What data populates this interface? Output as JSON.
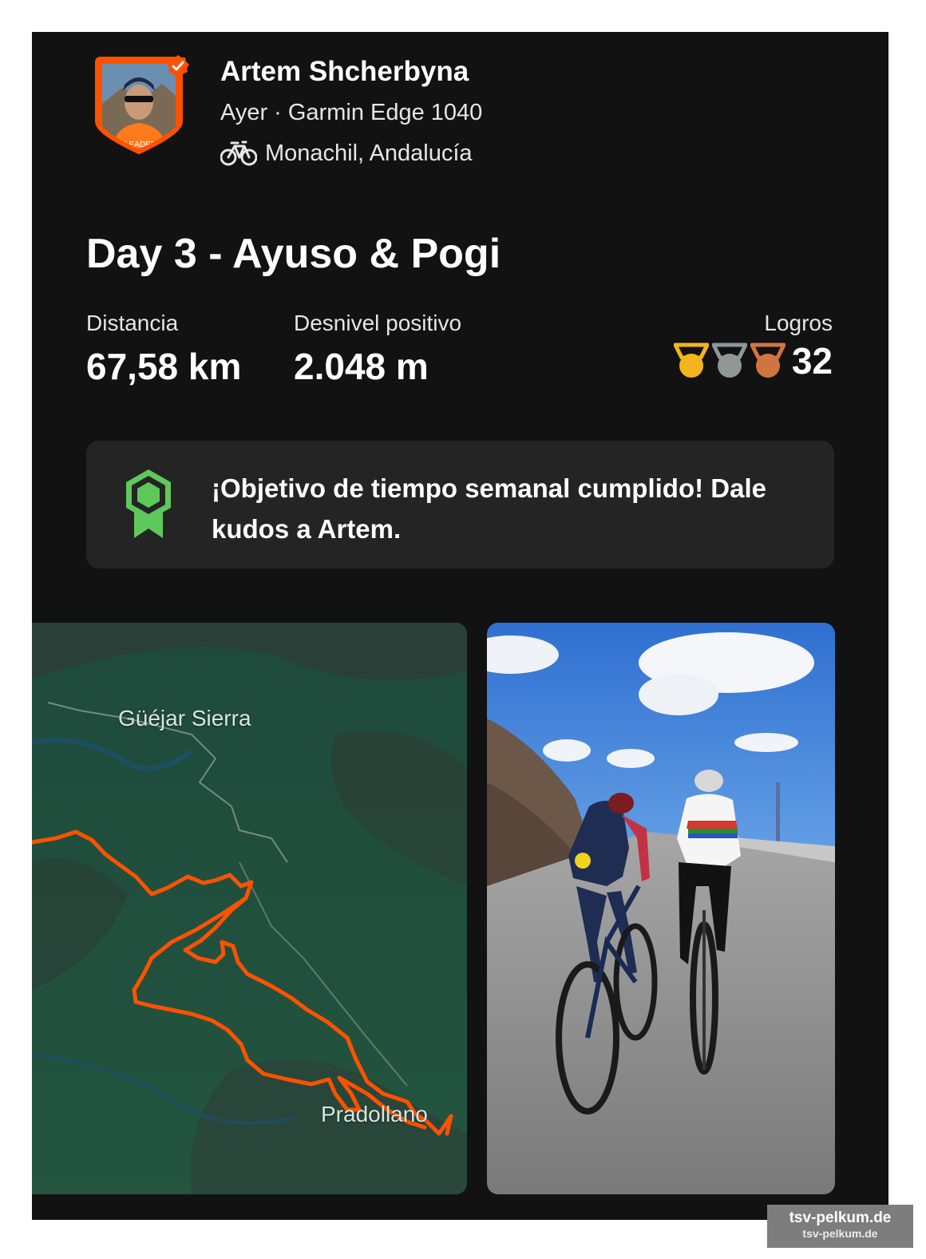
{
  "athlete": {
    "name": "Artem Shcherbyna",
    "meta": "Ayer · Garmin Edge 1040",
    "location": "Monachil, Andalucía",
    "avatar_icon": "athlete-avatar",
    "verified_icon": "verified-check-icon",
    "sport_icon": "bike-icon"
  },
  "activity": {
    "title": "Day 3 - Ayuso & Pogi"
  },
  "stats": {
    "distance_label": "Distancia",
    "distance_value": "67,58 km",
    "elevation_label": "Desnivel positivo",
    "elevation_value": "2.048 m",
    "achievements_label": "Logros",
    "achievements_count": "32",
    "medal_colors": [
      "#f2b51d",
      "#8f9797",
      "#d07540"
    ]
  },
  "goal_banner": {
    "text": "¡Objetivo de tiempo semanal cumplido! Dale kudos a Artem.",
    "icon": "goal-badge-icon",
    "icon_color": "#5ec95a"
  },
  "map": {
    "labels": [
      "Güéjar Sierra",
      "Pradollano"
    ],
    "route_color": "#fc5200"
  },
  "photo": {
    "description_icon": "cyclists-photo"
  },
  "watermark": {
    "line1": "tsv-pelkum.de",
    "line2": "tsv-pelkum.de"
  },
  "colors": {
    "accent": "#fc5200",
    "background": "#121212",
    "banner": "#242424"
  }
}
